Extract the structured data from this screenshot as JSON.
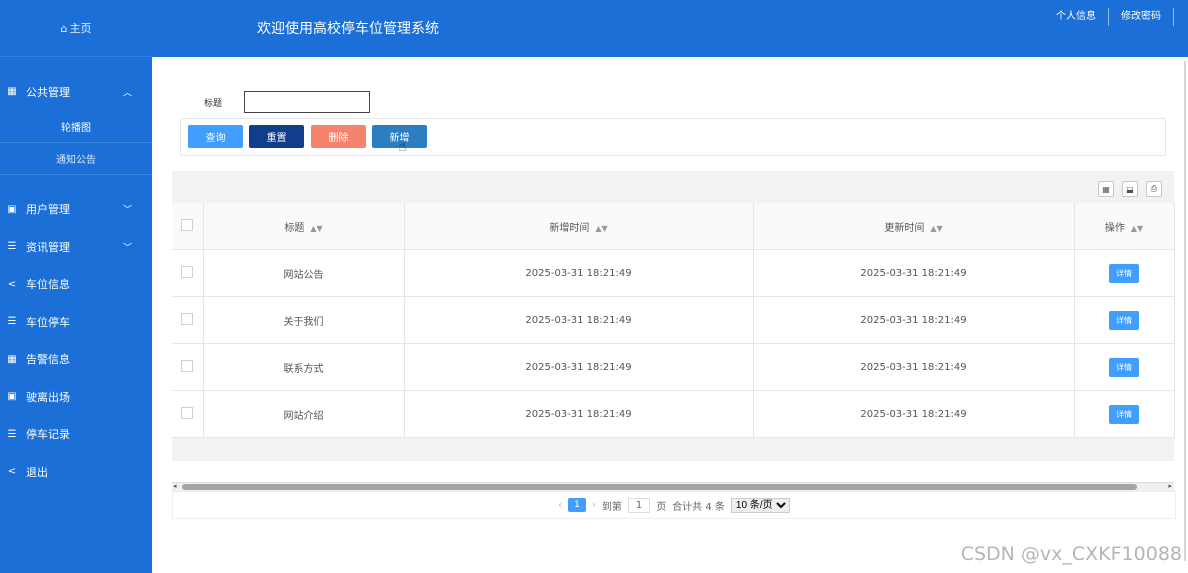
{
  "sidebar": {
    "home_label": "主页",
    "menus": [
      {
        "label": "公共管理",
        "icon": "grid-icon",
        "expanded": true,
        "children": [
          {
            "label": "轮播图"
          },
          {
            "label": "通知公告"
          }
        ]
      },
      {
        "label": "用户管理",
        "icon": "id-card-icon"
      },
      {
        "label": "资讯管理",
        "icon": "list-icon"
      },
      {
        "label": "车位信息",
        "icon": "share-icon"
      },
      {
        "label": "车位停车",
        "icon": "list-icon"
      },
      {
        "label": "告警信息",
        "icon": "grid-icon"
      },
      {
        "label": "驶离出场",
        "icon": "id-card-icon"
      },
      {
        "label": "停车记录",
        "icon": "list-icon"
      },
      {
        "label": "退出",
        "icon": "share-icon"
      }
    ]
  },
  "header": {
    "title": "欢迎使用高校停车位管理系统",
    "personal_info": "个人信息",
    "change_password": "修改密码"
  },
  "search": {
    "label": "标题",
    "value": ""
  },
  "buttons": {
    "query": "查询",
    "reset": "重置",
    "delete": "删除",
    "add": "新增"
  },
  "table": {
    "columns": [
      "标题",
      "新增时间",
      "更新时间",
      "操作"
    ],
    "rows": [
      {
        "title": "网站公告",
        "created": "2025-03-31 18:21:49",
        "updated": "2025-03-31 18:21:49",
        "action": "详情"
      },
      {
        "title": "关于我们",
        "created": "2025-03-31 18:21:49",
        "updated": "2025-03-31 18:21:49",
        "action": "详情"
      },
      {
        "title": "联系方式",
        "created": "2025-03-31 18:21:49",
        "updated": "2025-03-31 18:21:49",
        "action": "详情"
      },
      {
        "title": "网站介绍",
        "created": "2025-03-31 18:21:49",
        "updated": "2025-03-31 18:21:49",
        "action": "详情"
      }
    ]
  },
  "pagination": {
    "current_page": "1",
    "goto_label": "到第",
    "goto_value": "1",
    "page_suffix": "页",
    "total_text": "合计共 4 条",
    "page_size": "10 条/页"
  },
  "watermark": "CSDN @vx_CXKF10088"
}
